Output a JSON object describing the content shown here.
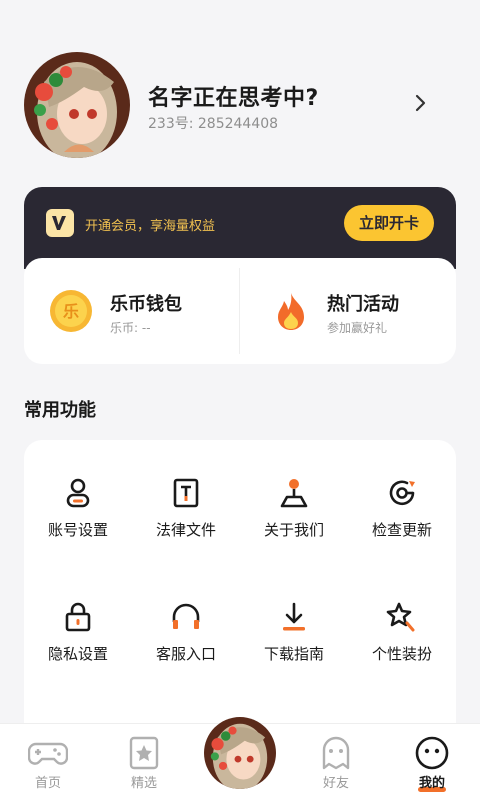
{
  "profile": {
    "name": "名字正在思考中?",
    "uid": "233号: 285244408"
  },
  "vip": {
    "text": "开通会员，享海量权益",
    "button": "立即开卡"
  },
  "wallet": {
    "coin_title": "乐币钱包",
    "coin_sub": "乐币: --",
    "coin_glyph": "乐",
    "event_title": "热门活动",
    "event_sub": "参加赢好礼"
  },
  "section": {
    "title": "常用功能"
  },
  "functions": [
    {
      "label": "账号设置",
      "icon": "account-icon"
    },
    {
      "label": "法律文件",
      "icon": "legal-icon"
    },
    {
      "label": "关于我们",
      "icon": "about-icon"
    },
    {
      "label": "检查更新",
      "icon": "update-icon"
    },
    {
      "label": "隐私设置",
      "icon": "lock-icon"
    },
    {
      "label": "客服入口",
      "icon": "headset-icon"
    },
    {
      "label": "下载指南",
      "icon": "download-icon"
    },
    {
      "label": "个性装扮",
      "icon": "sparkle-icon"
    }
  ],
  "tabs": [
    {
      "label": "首页",
      "icon": "gamepad-icon"
    },
    {
      "label": "精选",
      "icon": "star-card-icon"
    },
    {
      "label": "好友",
      "icon": "ghost-icon"
    },
    {
      "label": "我的",
      "icon": "face-icon"
    }
  ],
  "colors": {
    "accent": "#f2702a",
    "vip_bg": "#2a2833",
    "vip_gold": "#fbc531"
  }
}
